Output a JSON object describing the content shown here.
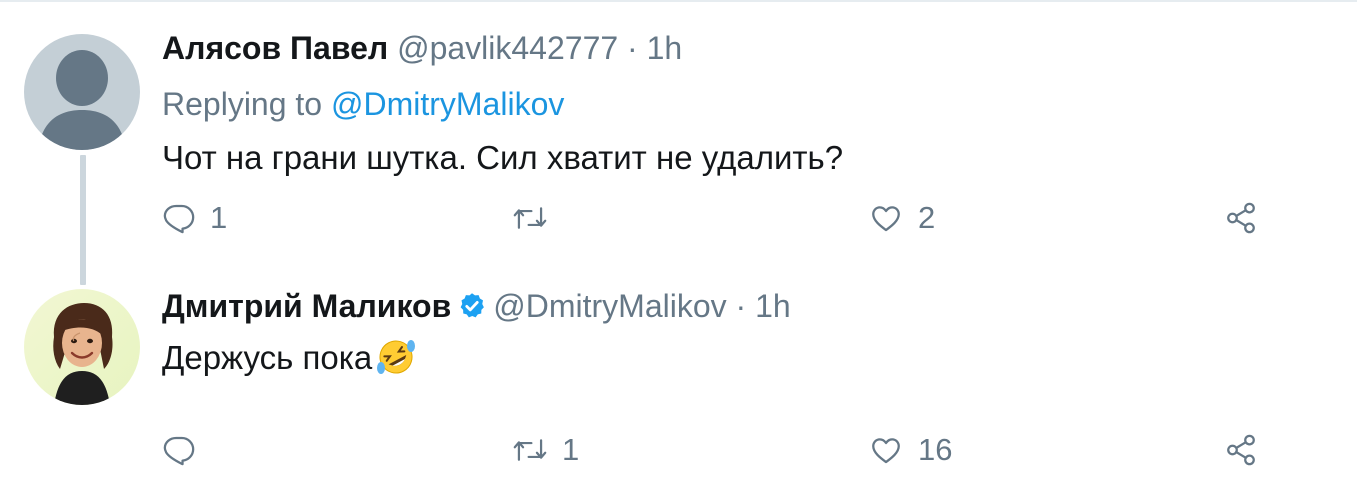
{
  "tweets": [
    {
      "name": "Алясов Павел",
      "handle": "@pavlik442777",
      "separator": "·",
      "time": "1h",
      "replying_prefix": "Replying to",
      "replying_to": "@DmitryMalikov",
      "text": "Чот на грани шутка. Сил хватит не удалить?",
      "reply_count": "1",
      "retweet_count": "",
      "like_count": "2",
      "avatar_icon": "default-user-avatar"
    },
    {
      "name": "Дмитрий Маликов",
      "verified": true,
      "handle": "@DmitryMalikov",
      "separator": "·",
      "time": "1h",
      "text": "Держусь пока",
      "emoji": "rolling-on-the-floor-laughing",
      "reply_count": "",
      "retweet_count": "1",
      "like_count": "16",
      "avatar_icon": "cartoon-man-avatar"
    }
  ],
  "colors": {
    "text": "#14171a",
    "secondary": "#657786",
    "link": "#1b95e0",
    "verified": "#1da1f2",
    "thread_line": "#ccd6dd"
  },
  "icons": [
    "reply-icon",
    "retweet-icon",
    "like-icon",
    "share-icon",
    "verified-badge-icon"
  ]
}
